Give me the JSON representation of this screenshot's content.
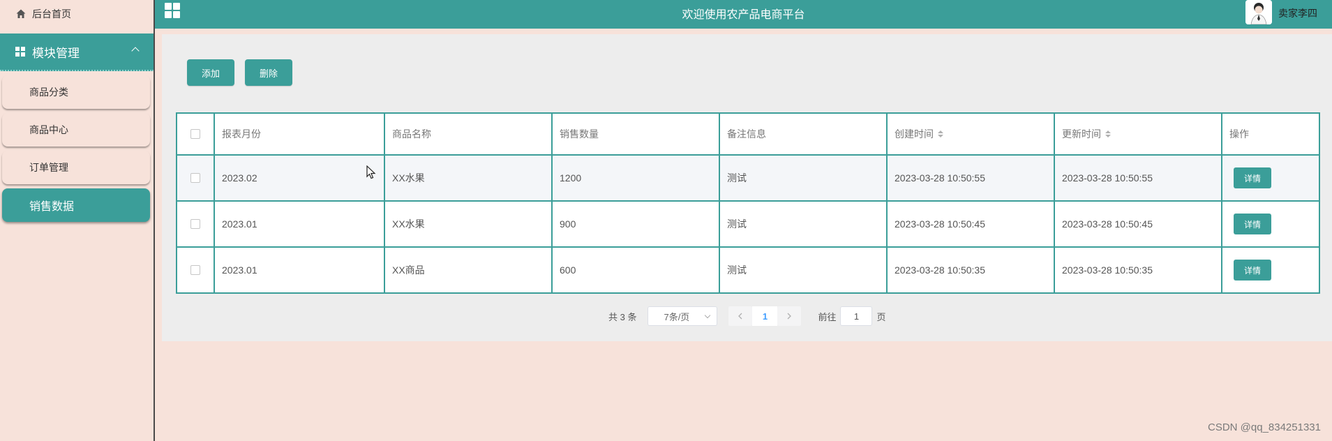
{
  "sidebar": {
    "home_label": "后台首页",
    "group_label": "模块管理",
    "items": [
      {
        "label": "商品分类"
      },
      {
        "label": "商品中心"
      },
      {
        "label": "订单管理"
      },
      {
        "label": "销售数据"
      }
    ]
  },
  "header": {
    "title": "欢迎使用农产品电商平台",
    "user": "卖家李四"
  },
  "toolbar": {
    "add_label": "添加",
    "delete_label": "删除"
  },
  "table": {
    "columns": [
      "报表月份",
      "商品名称",
      "销售数量",
      "备注信息",
      "创建时间",
      "更新时间",
      "操作"
    ],
    "rows": [
      {
        "month": "2023.02",
        "name": "XX水果",
        "qty": "1200",
        "note": "测试",
        "created": "2023-03-28 10:50:55",
        "updated": "2023-03-28 10:50:55",
        "action": "详情"
      },
      {
        "month": "2023.01",
        "name": "XX水果",
        "qty": "900",
        "note": "测试",
        "created": "2023-03-28 10:50:45",
        "updated": "2023-03-28 10:50:45",
        "action": "详情"
      },
      {
        "month": "2023.01",
        "name": "XX商品",
        "qty": "600",
        "note": "测试",
        "created": "2023-03-28 10:50:35",
        "updated": "2023-03-28 10:50:35",
        "action": "详情"
      }
    ]
  },
  "pagination": {
    "total": "共 3 条",
    "page_size": "7条/页",
    "current": "1",
    "goto_prefix": "前往",
    "goto_value": "1",
    "goto_suffix": "页"
  },
  "watermark": "CSDN @qq_834251331",
  "colors": {
    "accent": "#3b9e99",
    "background": "#f7e2da",
    "panel": "#ededed"
  }
}
